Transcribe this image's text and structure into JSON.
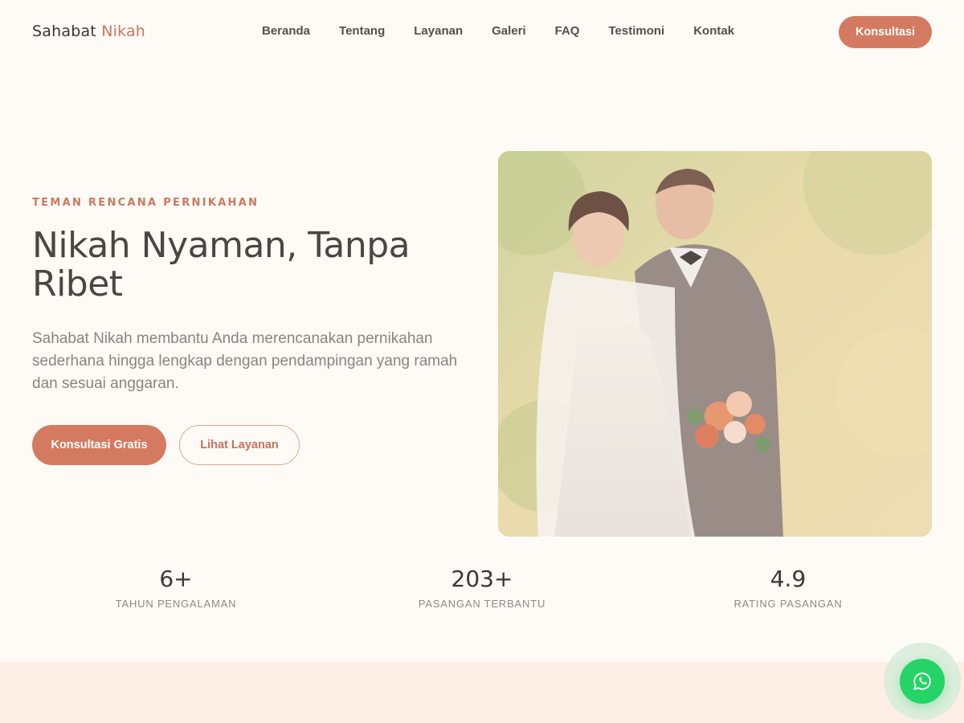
{
  "brand": {
    "name_part1": "Sahabat",
    "name_part2": "Nikah",
    "accent_color": "#d47a60"
  },
  "nav": {
    "links": [
      "Beranda",
      "Tentang",
      "Layanan",
      "Galeri",
      "FAQ",
      "Testimoni",
      "Kontak"
    ],
    "cta_label": "Konsultasi"
  },
  "hero": {
    "eyebrow": "TEMAN RENCANA PERNIKAHAN",
    "title": "Nikah Nyaman, Tanpa Ribet",
    "description": "Sahabat Nikah membantu Anda merencanakan pernikahan sederhana hingga lengkap dengan pendampingan yang ramah dan sesuai anggaran.",
    "primary_button": "Konsultasi Gratis",
    "secondary_button": "Lihat Layanan",
    "image_icon": "wedding-couple-photo"
  },
  "stats": [
    {
      "value": "6+",
      "label": "TAHUN PENGALAMAN"
    },
    {
      "value": "203+",
      "label": "PASANGAN TERBANTU"
    },
    {
      "value": "4.9",
      "label": "RATING PASANGAN"
    }
  ],
  "floating": {
    "icon": "whatsapp-icon",
    "color": "#25d366"
  }
}
